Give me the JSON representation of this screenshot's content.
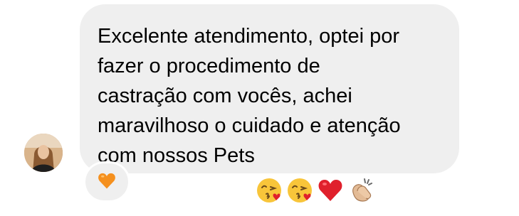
{
  "message": {
    "text": "Excelente atendimento, optei por\nfazer o procedimento de\ncastração com vocês, achei\nmaravilhoso o cuidado e atenção\ncom nossos Pets",
    "emojis": [
      "kissing-heart-emoji",
      "kissing-heart-emoji",
      "red-heart-emoji",
      "clapping-hands-emoji"
    ]
  },
  "reaction": {
    "emoji": "orange-heart-emoji"
  },
  "colors": {
    "bubble": "#efefef",
    "text": "#000000",
    "red_heart": "#e0202c",
    "orange_heart": "#f5901e",
    "emoji_face": "#f8c53a"
  }
}
